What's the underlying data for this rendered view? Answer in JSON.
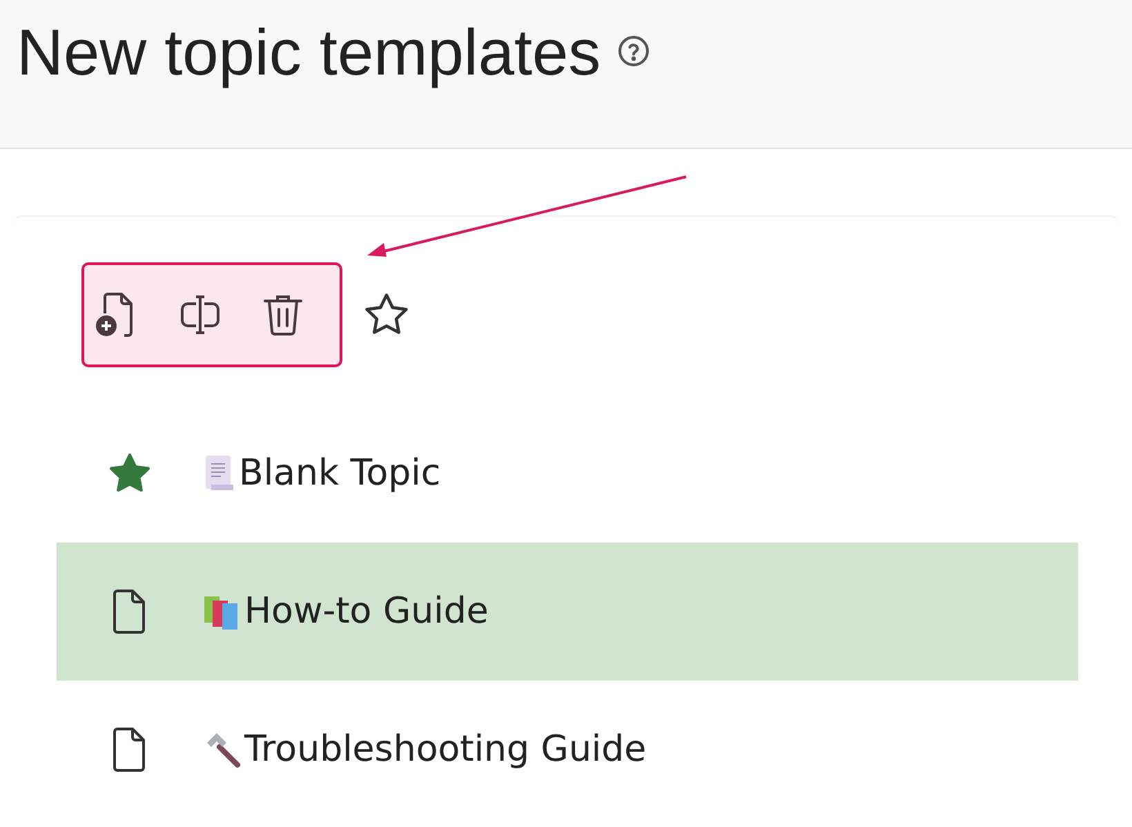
{
  "header": {
    "title": "New topic templates"
  },
  "templates": [
    {
      "name": "Blank Topic",
      "kind": "scroll",
      "starred": true,
      "selected": false
    },
    {
      "name": "How-to Guide",
      "kind": "books",
      "starred": false,
      "selected": true
    },
    {
      "name": "Troubleshooting Guide",
      "kind": "hammer",
      "starred": false,
      "selected": false
    }
  ]
}
